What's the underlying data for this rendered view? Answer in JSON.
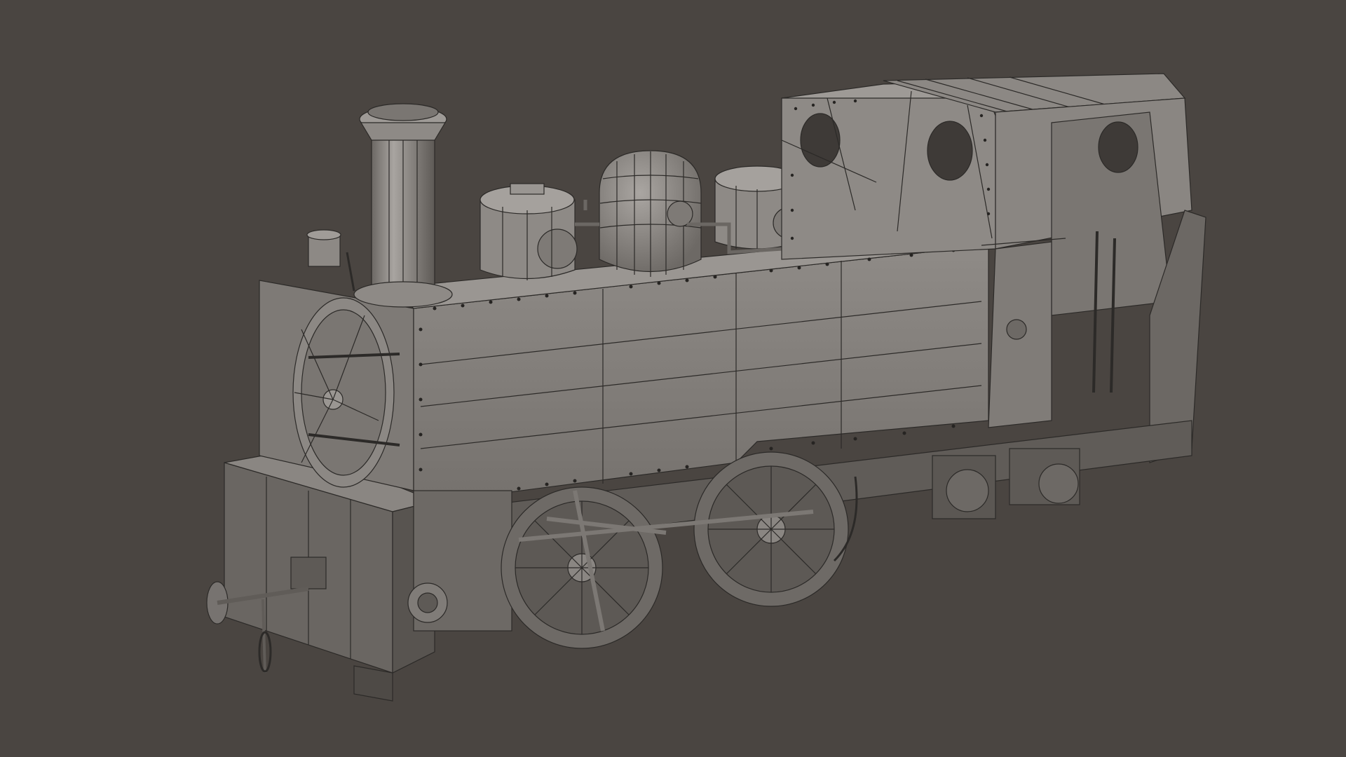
{
  "viewport": {
    "background": "#4a4541",
    "shading": "solid-wireframe",
    "model_subject": "steam-tank-locomotive"
  },
  "colors": {
    "body_light": "#8d8985",
    "body_mid": "#7c7874",
    "body_dark": "#625e5a",
    "wire": "#2c2a28",
    "rivet": "#262422"
  }
}
